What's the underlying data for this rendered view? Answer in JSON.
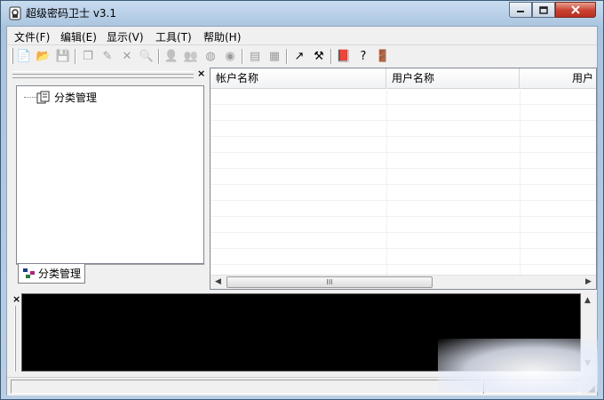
{
  "window": {
    "title": "超级密码卫士 v3.1"
  },
  "menu": [
    "文件(F)",
    "编辑(E)",
    "显示(V)",
    "工具(T)",
    "帮助(H)"
  ],
  "toolbar": {
    "buttons": [
      {
        "name": "new-icon",
        "glyph": "📄",
        "enabled": true
      },
      {
        "name": "open-icon",
        "glyph": "📂",
        "enabled": true
      },
      {
        "name": "save-icon",
        "glyph": "💾",
        "enabled": false
      },
      {
        "name": "copy-icon",
        "glyph": "❐",
        "enabled": false
      },
      {
        "name": "edit-icon",
        "glyph": "✎",
        "enabled": false
      },
      {
        "name": "delete-icon",
        "glyph": "✕",
        "enabled": false
      },
      {
        "name": "find-icon",
        "glyph": "🔍",
        "enabled": false
      },
      {
        "name": "user-icon",
        "glyph": "👤",
        "enabled": false
      },
      {
        "name": "users-icon",
        "glyph": "👥",
        "enabled": false
      },
      {
        "name": "globe-icon",
        "glyph": "◍",
        "enabled": false
      },
      {
        "name": "chat-icon",
        "glyph": "◉",
        "enabled": false
      },
      {
        "name": "card-icon",
        "glyph": "▤",
        "enabled": false
      },
      {
        "name": "cards-icon",
        "glyph": "▦",
        "enabled": false
      },
      {
        "name": "export-icon",
        "glyph": "↗",
        "enabled": true
      },
      {
        "name": "tools-icon",
        "glyph": "⚒",
        "enabled": true
      },
      {
        "name": "book-icon",
        "glyph": "📕",
        "enabled": true
      },
      {
        "name": "help-icon",
        "glyph": "?",
        "enabled": true
      },
      {
        "name": "exit-icon",
        "glyph": "🚪",
        "enabled": true
      }
    ]
  },
  "tree": {
    "root_label": "分类管理"
  },
  "left_tab": {
    "label": "分类管理"
  },
  "list": {
    "columns": [
      "帐户名称",
      "用户名称",
      "用户"
    ]
  },
  "scroll": {
    "thumb_glyph": "III"
  },
  "colors": {
    "output_bg": "#000000",
    "close_red": "#c94030"
  }
}
